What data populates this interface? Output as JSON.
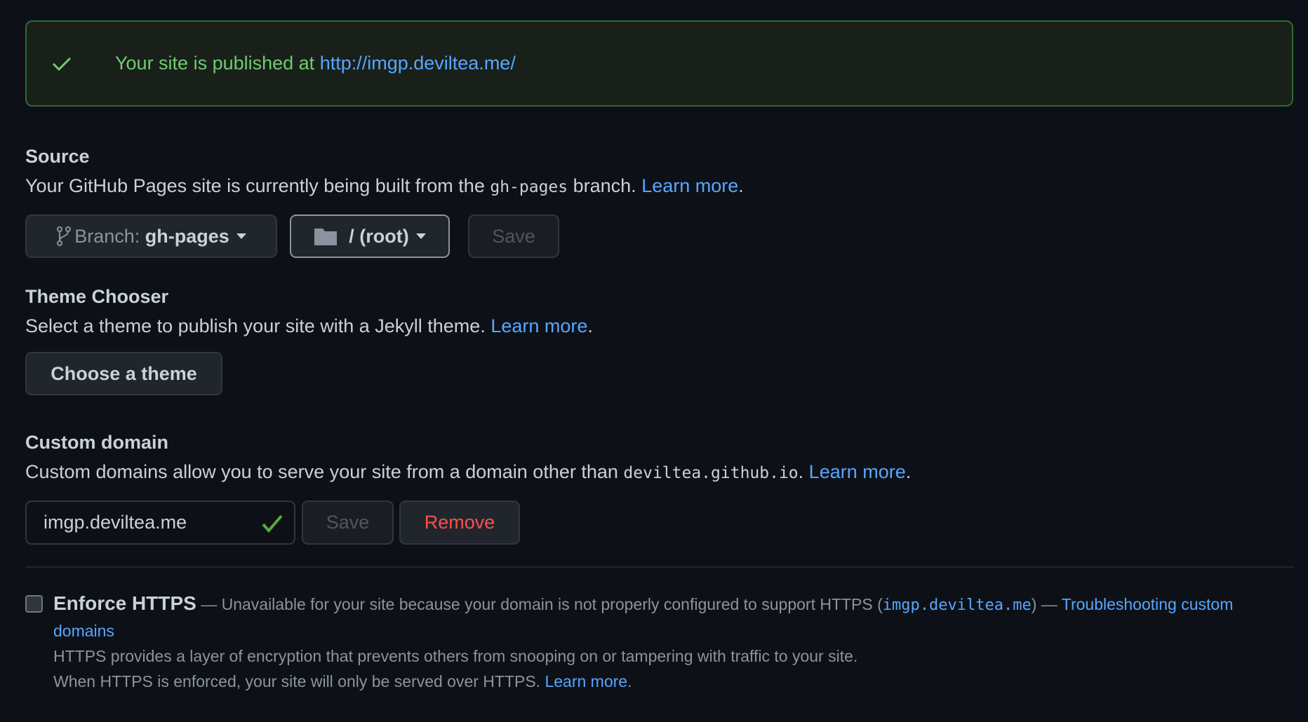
{
  "banner": {
    "text": "Your site is published at ",
    "url": "http://imgp.deviltea.me/",
    "icon": "check-icon",
    "color": "#6fcb72"
  },
  "source": {
    "title": "Source",
    "desc_pre": "Your GitHub Pages site is currently being built from the ",
    "branch_code": "gh-pages",
    "desc_post": " branch. ",
    "learn_more": "Learn more",
    "period": ".",
    "branch_label": "Branch: ",
    "branch_value": "gh-pages",
    "folder_value": "/ (root)",
    "save": "Save"
  },
  "theme": {
    "title": "Theme Chooser",
    "desc": "Select a theme to publish your site with a Jekyll theme. ",
    "learn_more": "Learn more",
    "period": ".",
    "button": "Choose a theme"
  },
  "domain": {
    "title": "Custom domain",
    "desc_pre": "Custom domains allow you to serve your site from a domain other than ",
    "domain_code": "deviltea.github.io",
    "desc_post": ". ",
    "learn_more": "Learn more",
    "period": ".",
    "input_value": "imgp.deviltea.me",
    "save": "Save",
    "remove": "Remove"
  },
  "https": {
    "checked": false,
    "label": "Enforce HTTPS",
    "unavail": " — Unavailable for your site because your domain is not properly configured to support HTTPS (",
    "domain_code": "imgp.deviltea.me",
    "after": ") — ",
    "troubleshoot": "Troubleshooting custom domains",
    "line1": "HTTPS provides a layer of encryption that prevents others from snooping on or tampering with traffic to your site.",
    "line2": "When HTTPS is enforced, your site will only be served over HTTPS. ",
    "learn_more": "Learn more",
    "period": "."
  }
}
